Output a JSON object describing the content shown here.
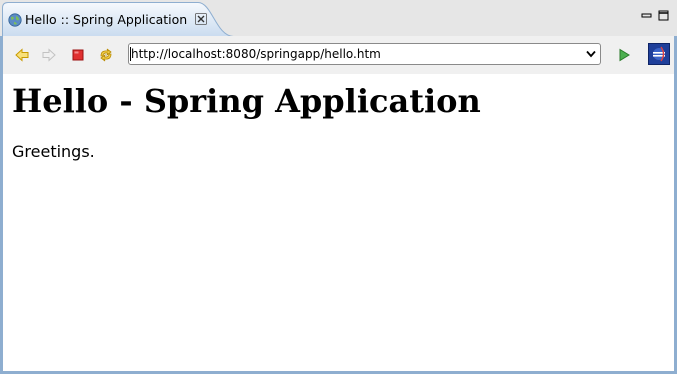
{
  "tab": {
    "title": "Hello :: Spring Application",
    "icon": "globe-icon",
    "close_icon": "close-icon"
  },
  "window_controls": {
    "minimize_icon": "minimize-icon",
    "maximize_icon": "maximize-icon"
  },
  "toolbar": {
    "back_icon": "back-arrow-icon",
    "forward_icon": "forward-arrow-icon",
    "stop_icon": "stop-icon",
    "refresh_icon": "refresh-icon",
    "url": "http://localhost:8080/springapp/hello.htm",
    "go_icon": "go-play-icon",
    "eclipse_icon": "eclipse-icon"
  },
  "page": {
    "heading": "Hello - Spring Application",
    "text": "Greetings."
  },
  "colors": {
    "frame_border": "#8eaed0",
    "tab_active": "#dde8f5",
    "stop_red": "#e03030",
    "go_green": "#3a9a3a",
    "back_yellow": "#e8b400"
  }
}
